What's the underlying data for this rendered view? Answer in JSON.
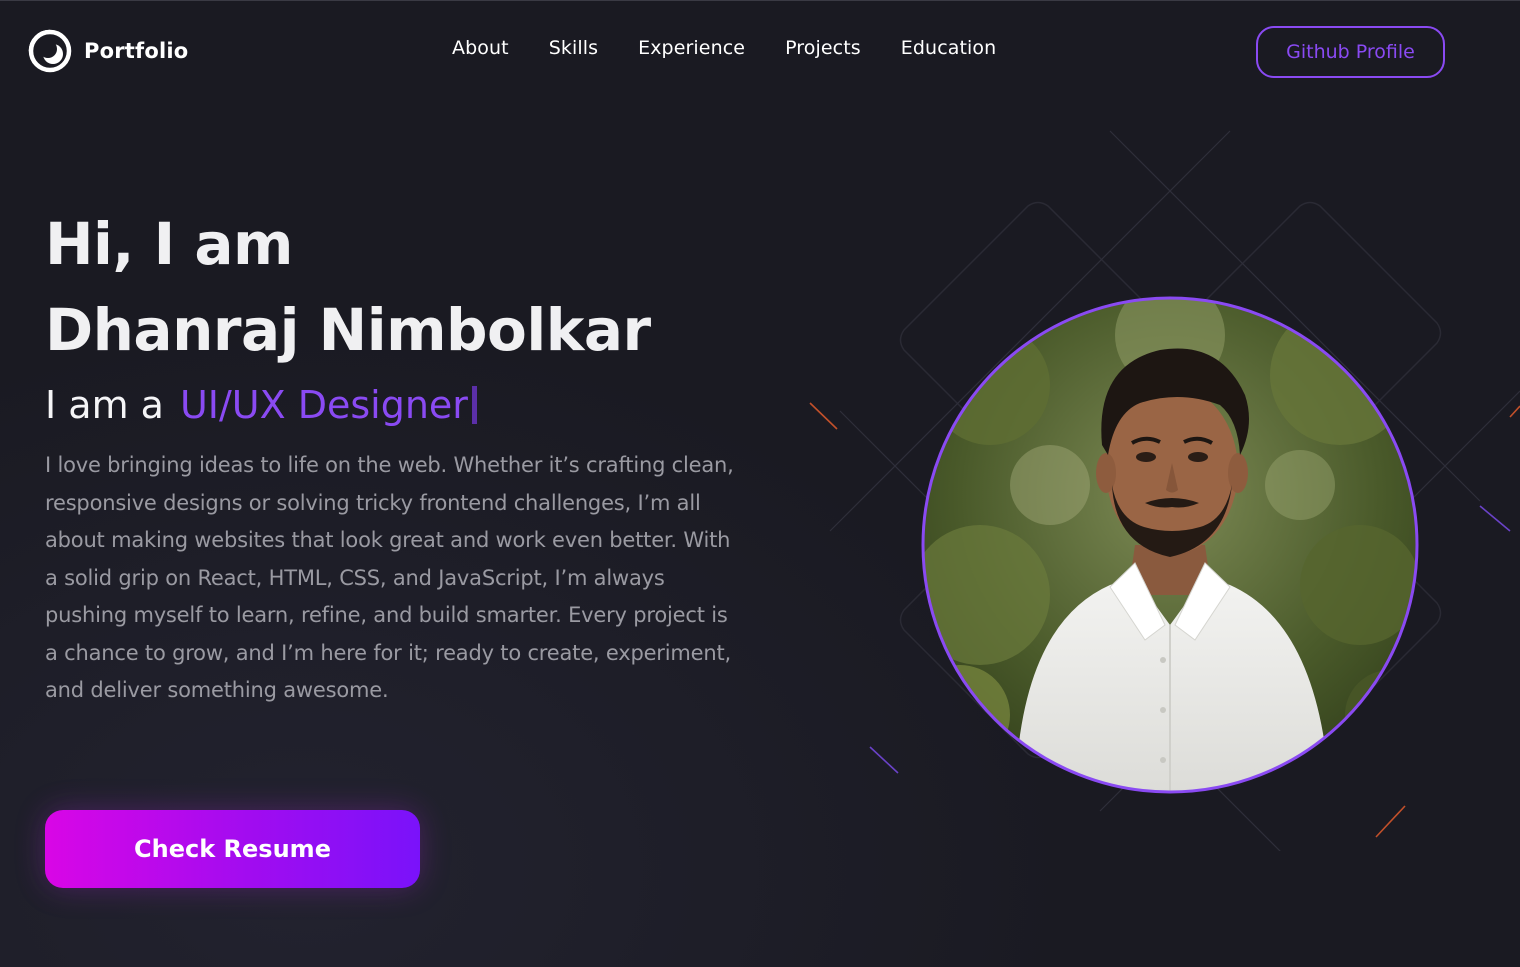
{
  "brand": {
    "name": "Portfolio",
    "logo_icon": "half-circle-logo-icon"
  },
  "nav": {
    "items": [
      {
        "label": "About"
      },
      {
        "label": "Skills"
      },
      {
        "label": "Experience"
      },
      {
        "label": "Projects"
      },
      {
        "label": "Education"
      }
    ],
    "github_label": "Github Profile"
  },
  "hero": {
    "greeting": "Hi, I am",
    "name": "Dhanraj Nimbolkar",
    "role_prefix": "I am a",
    "role_typed": "UI/UX Designer",
    "bio": "I love bringing ideas to life on the web. Whether it’s crafting clean, responsive designs or solving tricky frontend challenges, I’m all about making websites that look great and work even better. With a solid grip on React, HTML, CSS, and JavaScript, I’m always pushing myself to learn, refine, and build smarter. Every project is a chance to grow, and I’m here for it; ready to create, experiment, and deliver something awesome.",
    "resume_label": "Check Resume"
  },
  "colors": {
    "background": "#1a1a22",
    "accent_purple": "#8a4af3",
    "button_gradient_start": "#d906e6",
    "button_gradient_end": "#7a12fa",
    "body_text": "#9a9aa2"
  }
}
